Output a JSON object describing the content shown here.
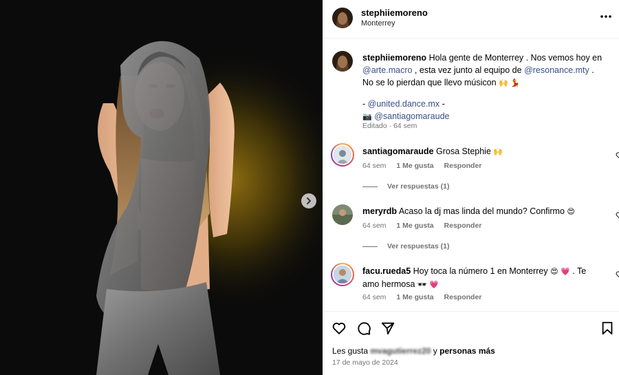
{
  "post": {
    "username": "stephiiemoreno",
    "location": "Monterrey",
    "more_icon": "more-horizontal-icon",
    "next_icon": "chevron-right-icon"
  },
  "caption": {
    "username": "stephiiemoreno",
    "text_1": "Hola gente de Monterrey . Nos vemos hoy en",
    "mention_1": "@arte.macro",
    "text_2": ", esta vez junto al equipo de",
    "mention_2": "@resonance.mty",
    "text_3": ". No se lo pierdan que llevo músicon",
    "emoji_1": "🙌 💃",
    "dash_prefix": "-",
    "mention_3": "@united.dance.mx",
    "dash_suffix": "-",
    "camera": "📷",
    "mention_4": "@santiagomaraude",
    "meta": "Editado · 64 sem"
  },
  "comments": [
    {
      "username": "santiagomaraude",
      "text": "Grosa Stephie",
      "emoji": "🙌",
      "time": "64 sem",
      "likes": "1 Me gusta",
      "reply": "Responder",
      "view_replies": "Ver respuestas (1)"
    },
    {
      "username": "meryrdb",
      "text": "Acaso la dj mas linda del mundo? Confirmo",
      "emoji": "😍",
      "time": "64 sem",
      "likes": "1 Me gusta",
      "reply": "Responder",
      "view_replies": "Ver respuestas (1)"
    },
    {
      "username": "facu.rueda5",
      "text_1": "Hoy toca la número 1 en Monterrey",
      "emoji_1": "😍 💗",
      "text_2": ". Te amo hermosa",
      "emoji_2": "🕶 💗",
      "time": "64 sem",
      "likes": "1 Me gusta",
      "reply": "Responder"
    }
  ],
  "footer": {
    "likes_prefix": "Les gusta",
    "likes_user": "mvagutierrez20",
    "likes_suffix": "y",
    "likes_others": "personas más",
    "date": "17 de mayo de 2024"
  },
  "colors": {
    "link": "#385185",
    "secondary_text": "#737373",
    "divider": "#efefef",
    "photo_background": "#0b0b0b"
  },
  "icons": [
    "heart-icon",
    "comment-icon",
    "share-icon",
    "bookmark-icon",
    "like-comment-icon"
  ]
}
